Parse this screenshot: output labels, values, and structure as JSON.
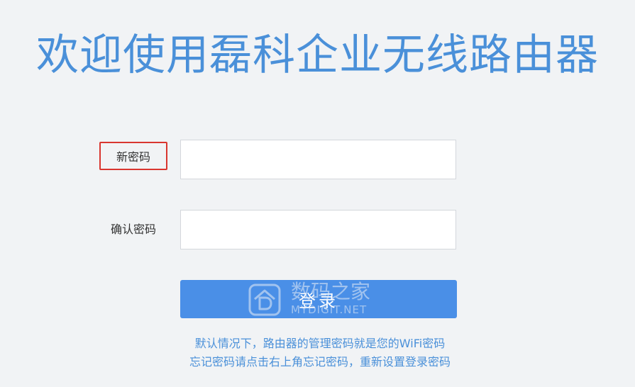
{
  "header": {
    "title": "欢迎使用磊科企业无线路由器"
  },
  "form": {
    "new_password": {
      "label": "新密码",
      "value": "",
      "placeholder": ""
    },
    "confirm_password": {
      "label": "确认密码",
      "value": "",
      "placeholder": ""
    },
    "login_button_label": "登录"
  },
  "hints": [
    "默认情况下，路由器的管理密码就是您的WiFi密码",
    "忘记密码请点击右上角忘记密码，重新设置登录密码"
  ],
  "watermark": {
    "name": "数码之家",
    "domain": "MYDIGIT.NET"
  },
  "colors": {
    "accent": "#4a90d9",
    "button": "#4a8fe7",
    "highlight_border": "#d9362f",
    "background": "#f1f3f5"
  }
}
